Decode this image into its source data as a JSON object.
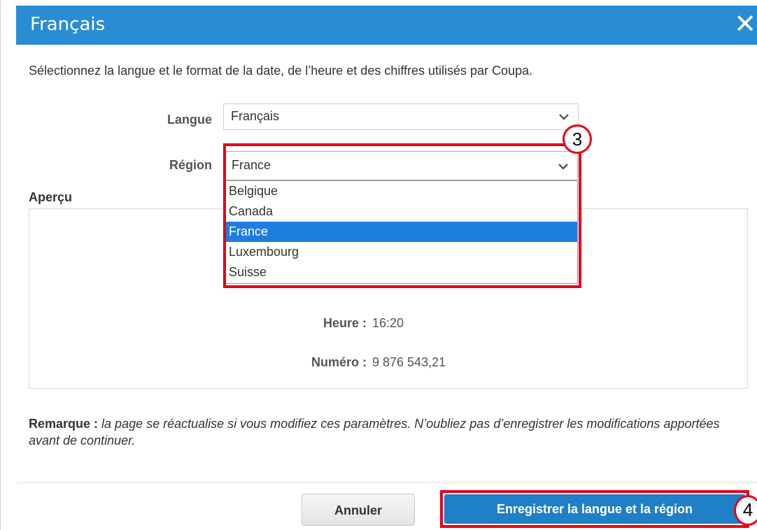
{
  "dialog": {
    "title": "Français",
    "close_icon": "close-icon"
  },
  "intro_text": "Sélectionnez la langue et le format de la date, de l’heure et des chiffres utilisés par Coupa.",
  "language": {
    "label": "Langue",
    "value": "Français"
  },
  "region": {
    "label": "Région",
    "value": "France",
    "options": [
      "Belgique",
      "Canada",
      "France",
      "Luxembourg",
      "Suisse"
    ],
    "selected_option": "France"
  },
  "preview": {
    "title": "Aperçu",
    "time_label": "Heure :",
    "time_value": "16:20",
    "number_label": "Numéro :",
    "number_value": "9 876 543,21"
  },
  "note": {
    "label": "Remarque :",
    "text": "la page se réactualise si vous modifiez ces paramètres. N’oubliez pas d’enregistrer les modifications apportées avant de continuer."
  },
  "buttons": {
    "cancel": "Annuler",
    "save": "Enregistrer la langue et la région"
  },
  "callouts": {
    "step_3": "3",
    "step_4": "4"
  },
  "colors": {
    "header": "#2a8dd4",
    "highlight": "#e6001a",
    "selected_option": "#1e7ee0",
    "primary_button": "#1f7fc7"
  }
}
